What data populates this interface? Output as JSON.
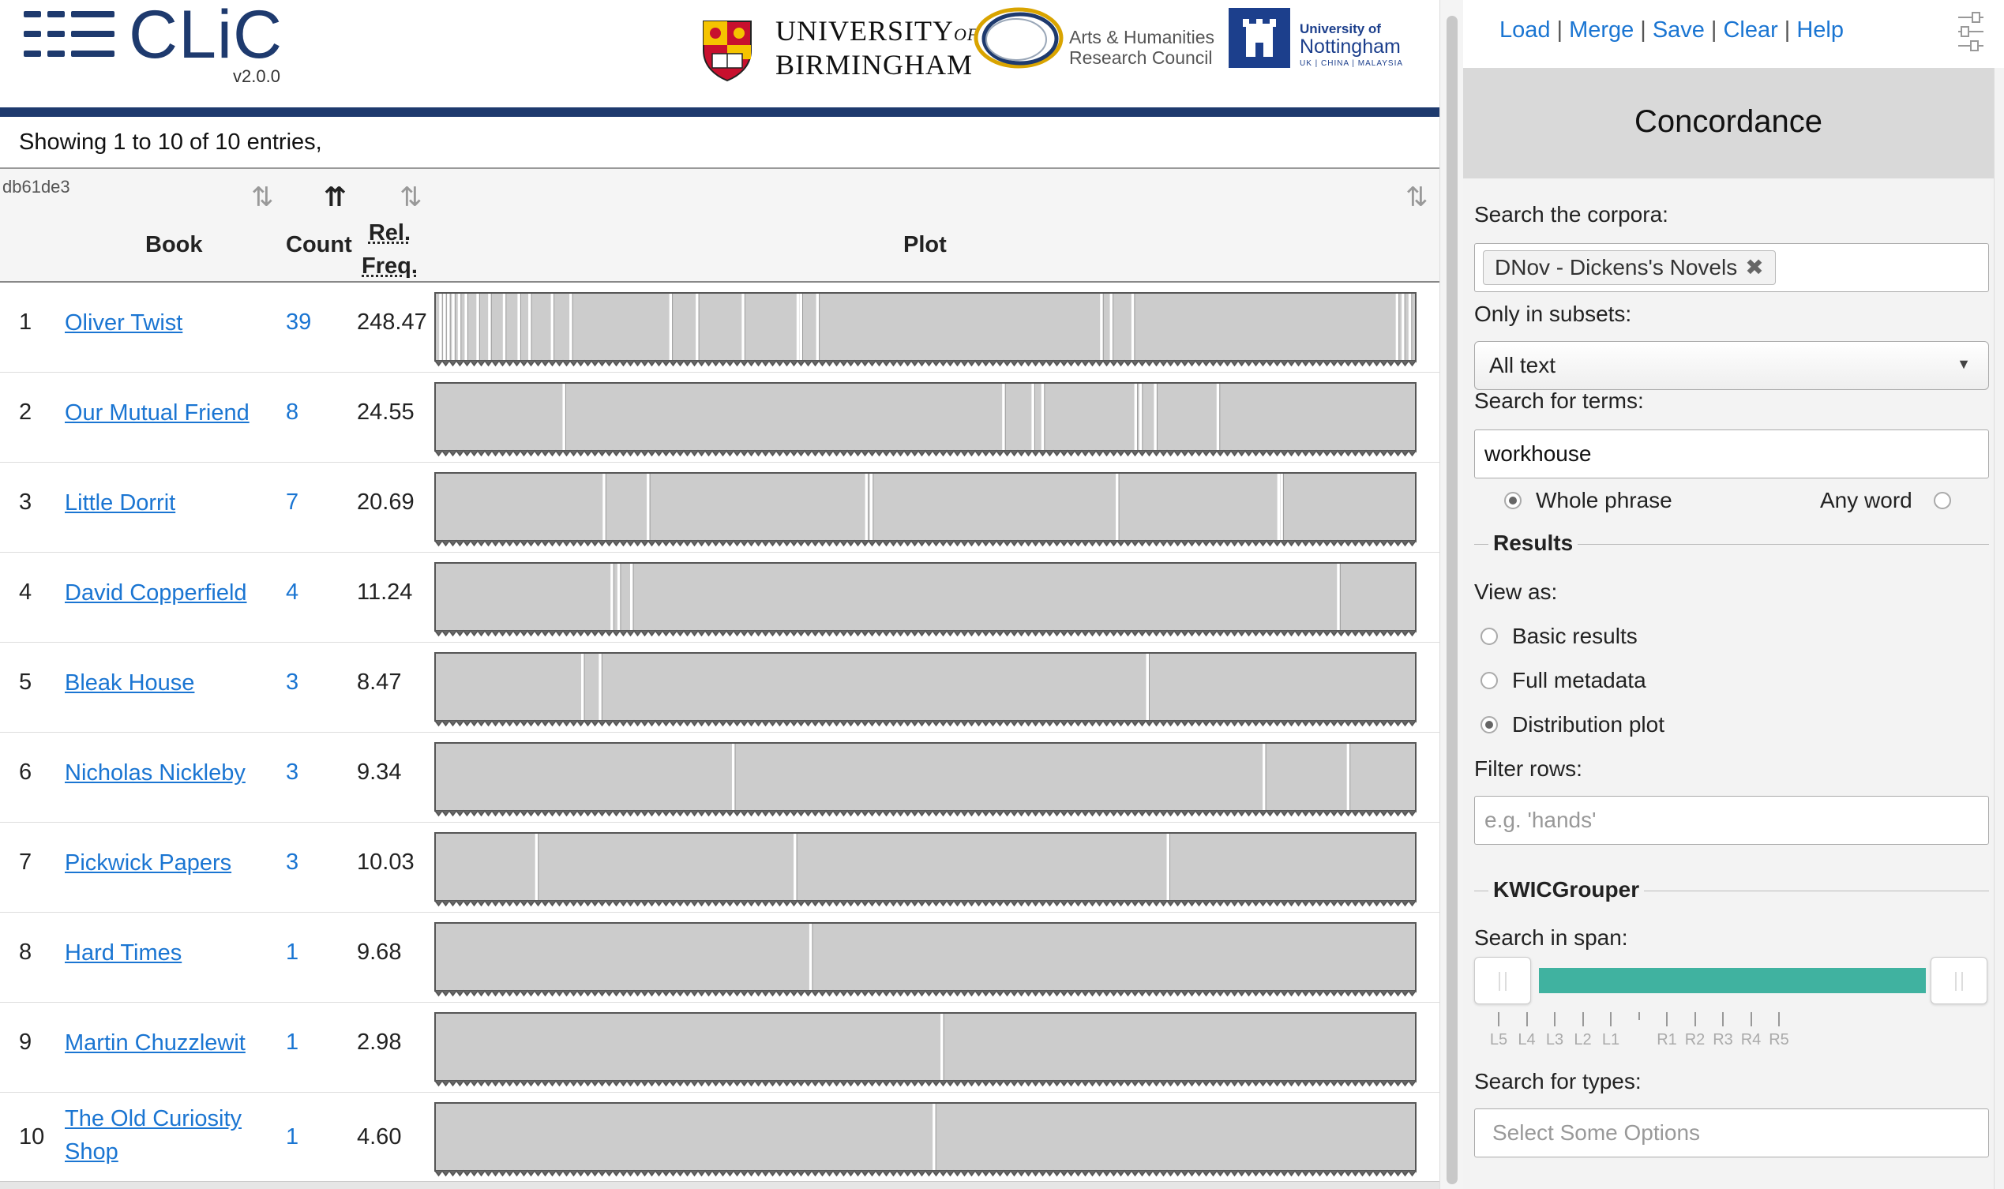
{
  "app": {
    "title": "CLiC",
    "version": "v2.0.0"
  },
  "logos": {
    "birmingham_line1": "UNIVERSITY",
    "birmingham_of": "OF",
    "birmingham_line2": "BIRMINGHAM",
    "ahrc_line1": "Arts & Humanities",
    "ahrc_line2": "Research Council",
    "nottingham_line1": "University of",
    "nottingham_line2": "Nottingham",
    "nottingham_line3": "UK | CHINA | MALAYSIA"
  },
  "table": {
    "showing": "Showing 1 to 10 of 10 entries,",
    "query_id": "db61de3",
    "columns": {
      "book": "Book",
      "count": "Count",
      "relfreq_1": "Rel.",
      "relfreq_2": "Freq.",
      "plot": "Plot"
    },
    "rows": [
      {
        "num": "1",
        "book": "Oliver Twist",
        "count": "39",
        "freq": "248.47",
        "hits": [
          0.005,
          0.009,
          0.013,
          0.018,
          0.024,
          0.031,
          0.043,
          0.055,
          0.07,
          0.085,
          0.096,
          0.119,
          0.138,
          0.24,
          0.267,
          0.314,
          0.37,
          0.373,
          0.39,
          0.68,
          0.69,
          0.712,
          0.982,
          0.988,
          0.995
        ]
      },
      {
        "num": "2",
        "book": "Our Mutual Friend",
        "count": "8",
        "freq": "24.55",
        "hits": [
          0.131,
          0.58,
          0.61,
          0.62,
          0.715,
          0.72,
          0.735,
          0.799
        ]
      },
      {
        "num": "3",
        "book": "Little Dorrit",
        "count": "7",
        "freq": "20.69",
        "hits": [
          0.172,
          0.217,
          0.44,
          0.445,
          0.696,
          0.861,
          0.864
        ]
      },
      {
        "num": "4",
        "book": "David Copperfield",
        "count": "4",
        "freq": "11.24",
        "hits": [
          0.18,
          0.187,
          0.2,
          0.922
        ]
      },
      {
        "num": "5",
        "book": "Bleak House",
        "count": "3",
        "freq": "8.47",
        "hits": [
          0.15,
          0.168,
          0.727
        ]
      },
      {
        "num": "6",
        "book": "Nicholas Nickleby",
        "count": "3",
        "freq": "9.34",
        "hits": [
          0.304,
          0.846,
          0.932
        ]
      },
      {
        "num": "7",
        "book": "Pickwick Papers",
        "count": "3",
        "freq": "10.03",
        "hits": [
          0.103,
          0.367,
          0.748
        ]
      },
      {
        "num": "8",
        "book": "Hard Times",
        "count": "1",
        "freq": "9.68",
        "hits": [
          0.383
        ]
      },
      {
        "num": "9",
        "book": "Martin Chuzzlewit",
        "count": "1",
        "freq": "2.98",
        "hits": [
          0.517
        ]
      },
      {
        "num": "10",
        "book": "The Old Curiosity Shop",
        "count": "1",
        "freq": "4.60",
        "hits": [
          0.509
        ]
      }
    ]
  },
  "panel": {
    "menu": {
      "load": "Load",
      "merge": "Merge",
      "save": "Save",
      "clear": "Clear",
      "help": "Help"
    },
    "title": "Concordance",
    "search_corpora_label": "Search the corpora:",
    "corpus_chip": "DNov - Dickens's Novels",
    "corpus_chip_remove": "✖",
    "subsets_label": "Only in subsets:",
    "subset_value": "All text",
    "subset_arrow": "▼",
    "terms_label": "Search for terms:",
    "terms_value": "workhouse",
    "whole_phrase": "Whole phrase",
    "any_word": "Any word",
    "results_legend": "Results",
    "view_as_label": "View as:",
    "view_basic": "Basic results",
    "view_full": "Full metadata",
    "view_dist": "Distribution plot",
    "filter_label": "Filter rows:",
    "filter_placeholder": "e.g. 'hands'",
    "kwic_legend": "KWICGrouper",
    "span_label": "Search in span:",
    "span_ticks": [
      "L5",
      "L4",
      "L3",
      "L2",
      "L1",
      "",
      "R1",
      "R2",
      "R3",
      "R4",
      "R5"
    ],
    "types_label": "Search for types:",
    "types_placeholder": "Select Some Options"
  },
  "colors": {
    "brand": "#1e3a6e",
    "link": "#1a75d2",
    "plot_fill": "#cccccc",
    "slider_fill": "#40b2a0"
  }
}
